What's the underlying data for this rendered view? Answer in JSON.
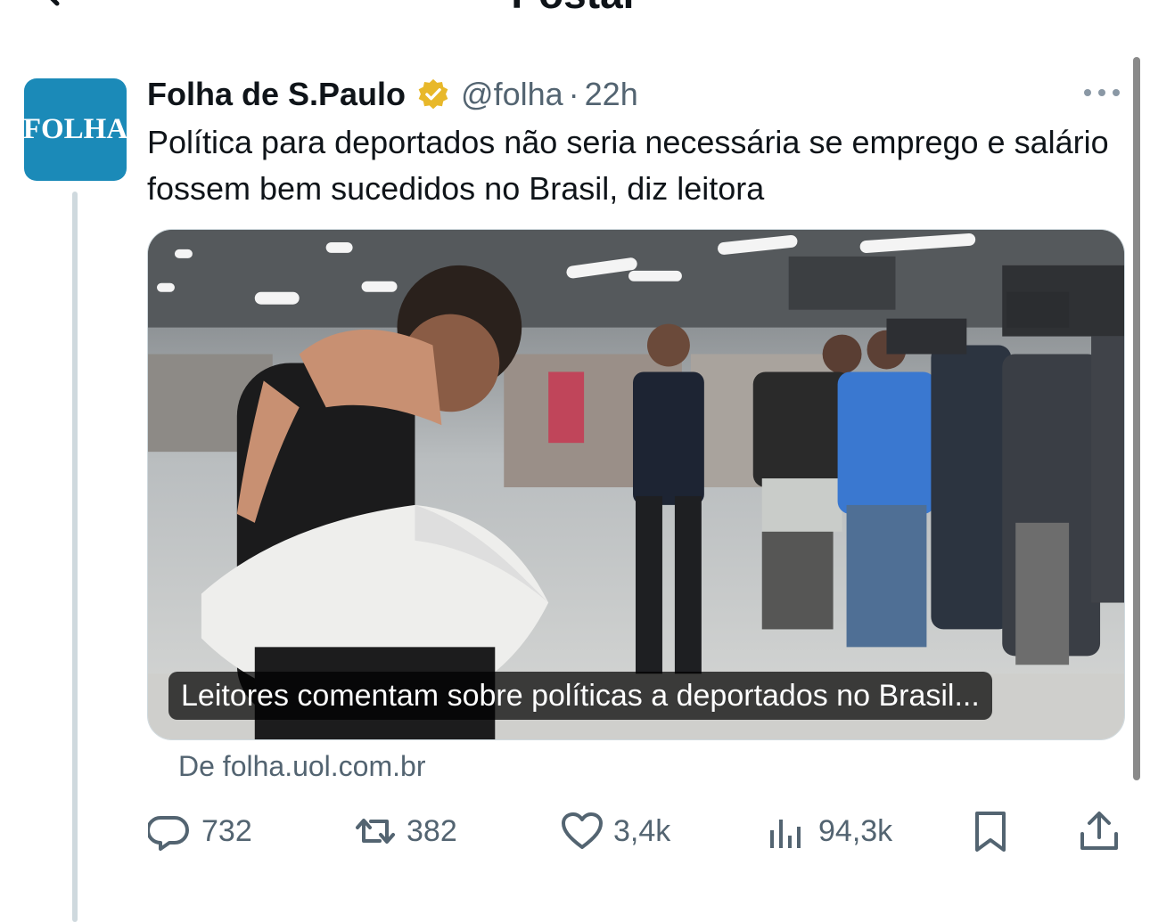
{
  "header": {
    "title": "Postar"
  },
  "post": {
    "author_name": "Folha de S.Paulo",
    "handle": "@folha",
    "separator": "·",
    "time": "22h",
    "avatar_text": "FOLHA",
    "text": "Política para deportados não seria necessária se emprego e salário fossem bem sucedidos no Brasil, diz leitora",
    "card": {
      "caption": "Leitores comentam sobre políticas a deportados no Brasil...",
      "source": "De folha.uol.com.br"
    },
    "stats": {
      "replies": "732",
      "reposts": "382",
      "likes": "3,4k",
      "views": "94,3k"
    }
  },
  "icons": [
    "back-arrow-icon",
    "verified-icon",
    "more-icon",
    "reply-icon",
    "repost-icon",
    "like-icon",
    "views-icon",
    "bookmark-icon",
    "share-icon"
  ],
  "colors": {
    "avatar_bg": "#1b8ab8",
    "verified": "#e8b82a",
    "muted_text": "#536471",
    "thread_line": "#cfd9de"
  }
}
